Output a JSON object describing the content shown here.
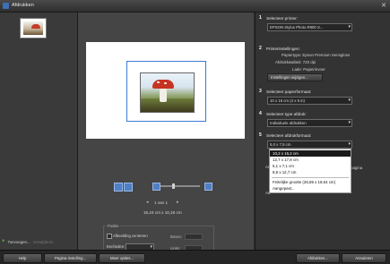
{
  "window": {
    "title": "Afdrukken",
    "close_glyph": "✕"
  },
  "left_panel": {
    "add_label": "Toevoegen...",
    "remove_label": "Verwijderen"
  },
  "preview": {
    "page_counter": "1 van 1",
    "print_size": "15,24 cm x 10,16 cm"
  },
  "position": {
    "legend": "Positie",
    "center_checkbox": "Afbeelding centreren",
    "units_label": "Eenheden:",
    "units_value": "",
    "top_label": "Boven:",
    "left_label": "Links:"
  },
  "steps": {
    "printer": {
      "num": "1",
      "title": "Selecteer printer:",
      "value": "EPSON Stylus Photo R800 S..."
    },
    "printer_settings": {
      "num": "2",
      "title": "Printerinstellingen:",
      "paper_type": "Papiertype: Epson Premium Semigloss",
      "quality": "Afdrukkwaliteit: 720 dpi",
      "tray": "Lade: Papierinvoer",
      "button": "Instellingen wijzigen..."
    },
    "paper_size": {
      "num": "3",
      "title": "Selecteer papierformaat:",
      "value": "10 x 15 cm (4 x 6 in)"
    },
    "print_type": {
      "num": "4",
      "title": "Selecteer type afdruk:",
      "value": "Individuele afdrukken"
    },
    "print_size": {
      "num": "5",
      "title": "Selecteer afdrukformaat:",
      "value": "5,0 x 7,5 cm"
    },
    "print_size_options": [
      "10,2 x 15,2 cm",
      "12,7 x 17,8 cm",
      "5,1 x 7,1 cm",
      "8,9 x 12,7 cm",
      "Feitelijke grootte (26,85 x 18,64 cm)",
      "Aangepast..."
    ],
    "partial_labels": [
      "Aa",
      "Aa"
    ],
    "partial_right": "pagina"
  },
  "bottom": {
    "help": "Help",
    "page_setup": "Pagina-instelling...",
    "more_options": "Meer opties...",
    "print": "Afdrukken...",
    "cancel": "Annuleren"
  },
  "colors": {
    "accent": "#3b7bd4",
    "add_icon": "#6fba3b",
    "panel": "#454545"
  },
  "icons": {
    "add": "plus-icon",
    "rotate_left": "rotate-left-icon",
    "rotate_right": "rotate-right-icon",
    "zoom_out": "zoom-out-icon",
    "zoom_in": "zoom-in-icon"
  }
}
